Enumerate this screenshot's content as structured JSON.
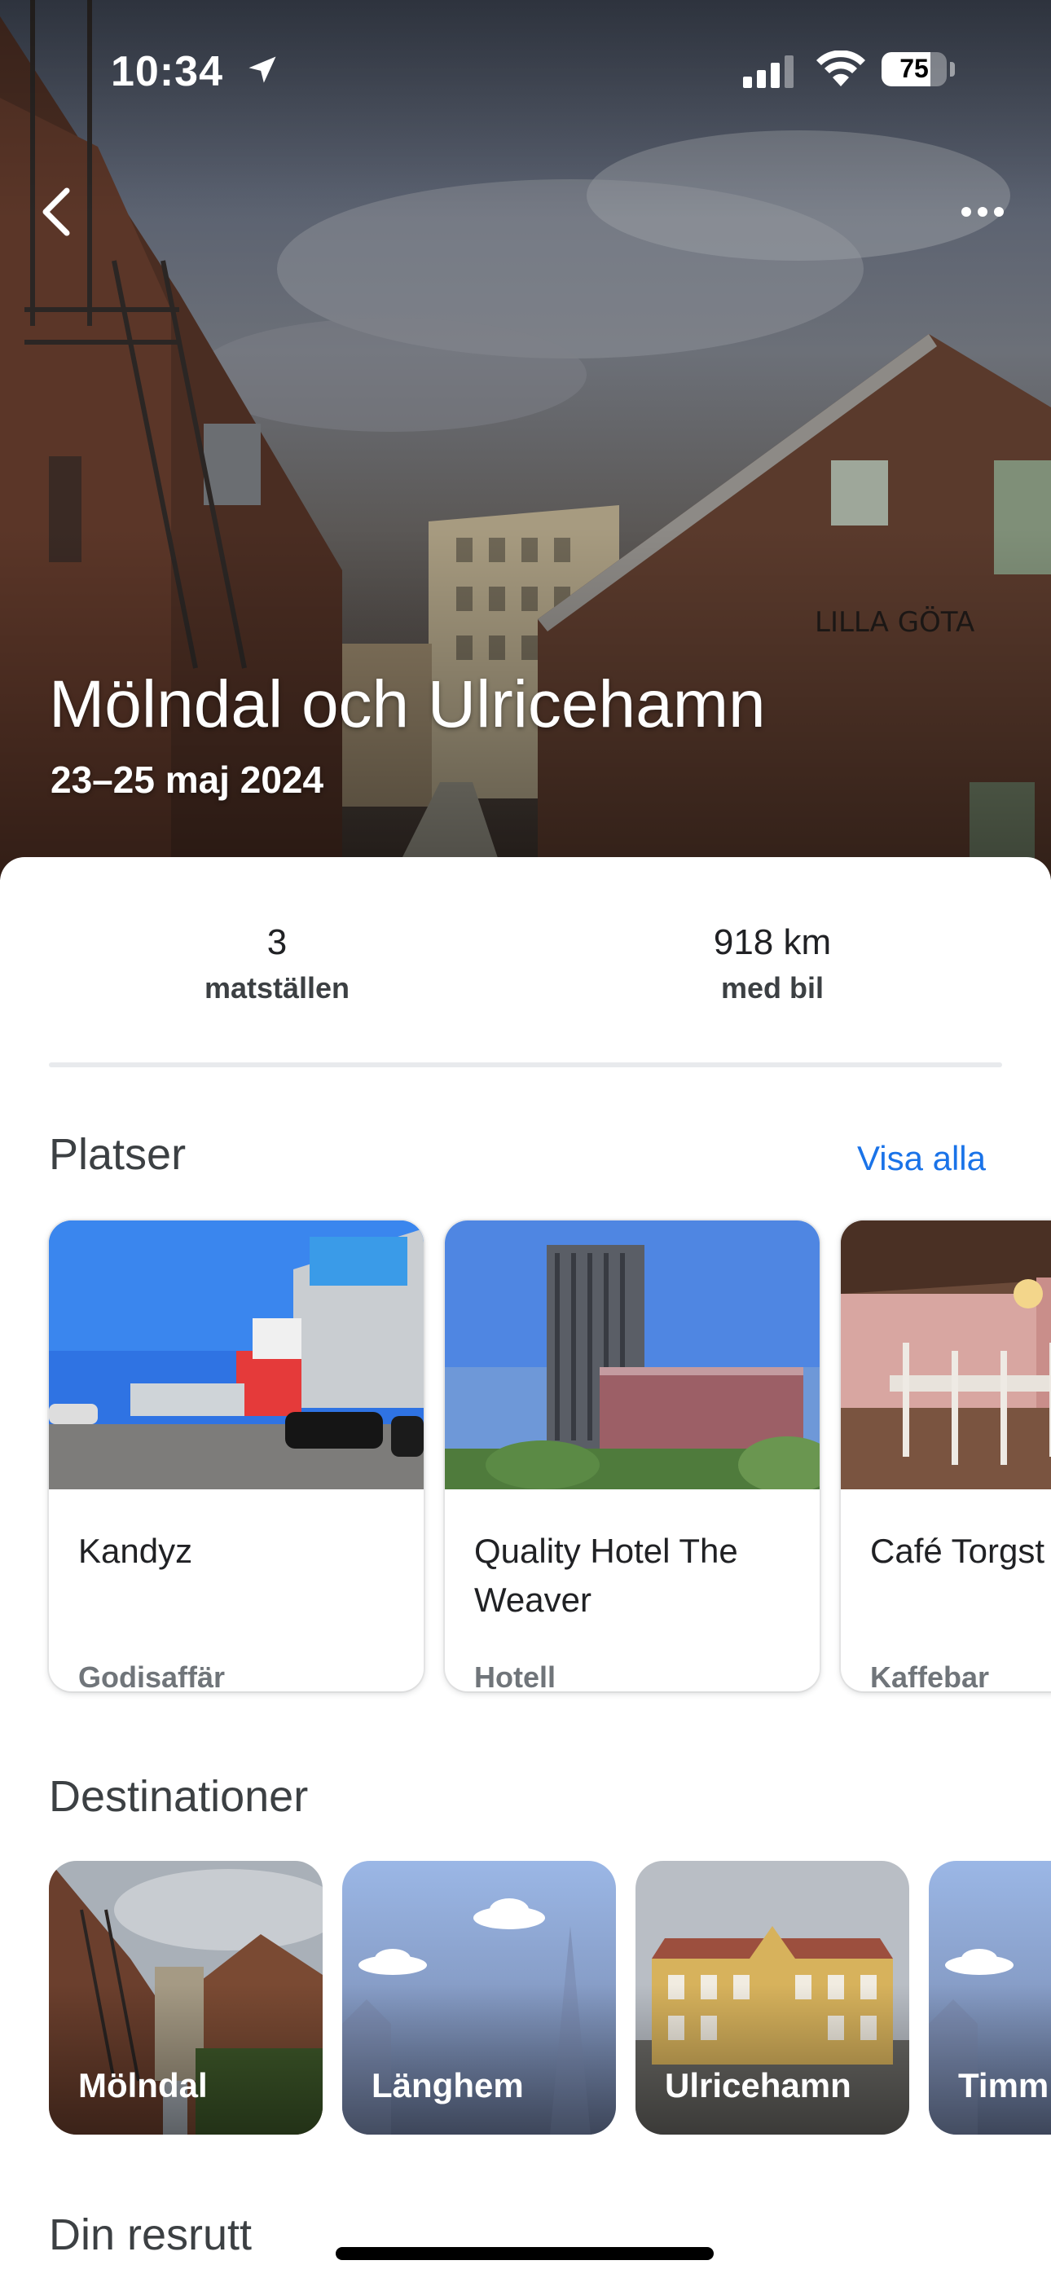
{
  "status_bar": {
    "time": "10:34",
    "battery": "75",
    "battery_level": 0.75
  },
  "hero": {
    "title": "Mölndal och Ulricehamn",
    "dates": "23–25 maj 2024"
  },
  "stats": [
    {
      "value": "3",
      "label": "matställen"
    },
    {
      "value": "918 km",
      "label": "med bil"
    }
  ],
  "places": {
    "title": "Platser",
    "view_all": "Visa alla",
    "items": [
      {
        "name": "Kandyz",
        "category": "Godisaffär"
      },
      {
        "name": "Quality Hotel The Weaver",
        "category": "Hotell"
      },
      {
        "name": "Café Torgst",
        "category": "Kaffebar"
      }
    ]
  },
  "destinations": {
    "title": "Destinationer",
    "items": [
      {
        "name": "Mölndal"
      },
      {
        "name": "Länghem"
      },
      {
        "name": "Ulricehamn"
      },
      {
        "name": "Timm"
      }
    ]
  },
  "route": {
    "title": "Din resrutt"
  },
  "colors": {
    "accent": "#1a73e8",
    "text": "#202124",
    "secondary": "#70757a"
  }
}
